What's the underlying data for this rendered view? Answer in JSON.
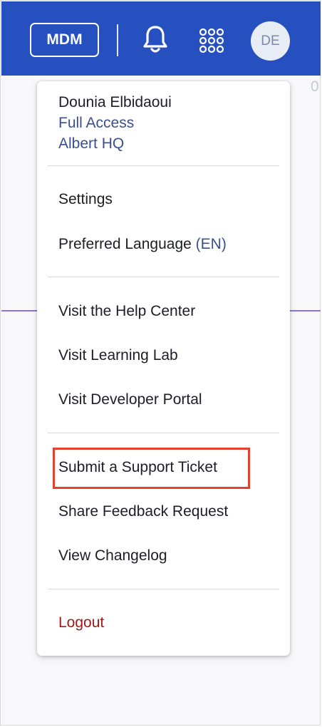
{
  "header": {
    "mdm_label": "MDM",
    "avatar_initials": "DE"
  },
  "background": {
    "edge_digit": "0"
  },
  "menu": {
    "user": {
      "name": "Dounia Elbidaoui",
      "role": "Full Access",
      "organization": "Albert HQ"
    },
    "settings": "Settings",
    "preferred_language": "Preferred Language",
    "language_code": "(EN)",
    "help_center": "Visit the Help Center",
    "learning_lab": "Visit Learning Lab",
    "developer_portal": "Visit Developer Portal",
    "support_ticket": "Submit a Support Ticket",
    "share_feedback": "Share Feedback Request",
    "changelog": "View Changelog",
    "logout": "Logout"
  },
  "colors": {
    "header_bg": "#2650c0",
    "logout_text": "#a31818",
    "highlight_border": "#e2412e",
    "link_text": "#3b4f8f"
  }
}
